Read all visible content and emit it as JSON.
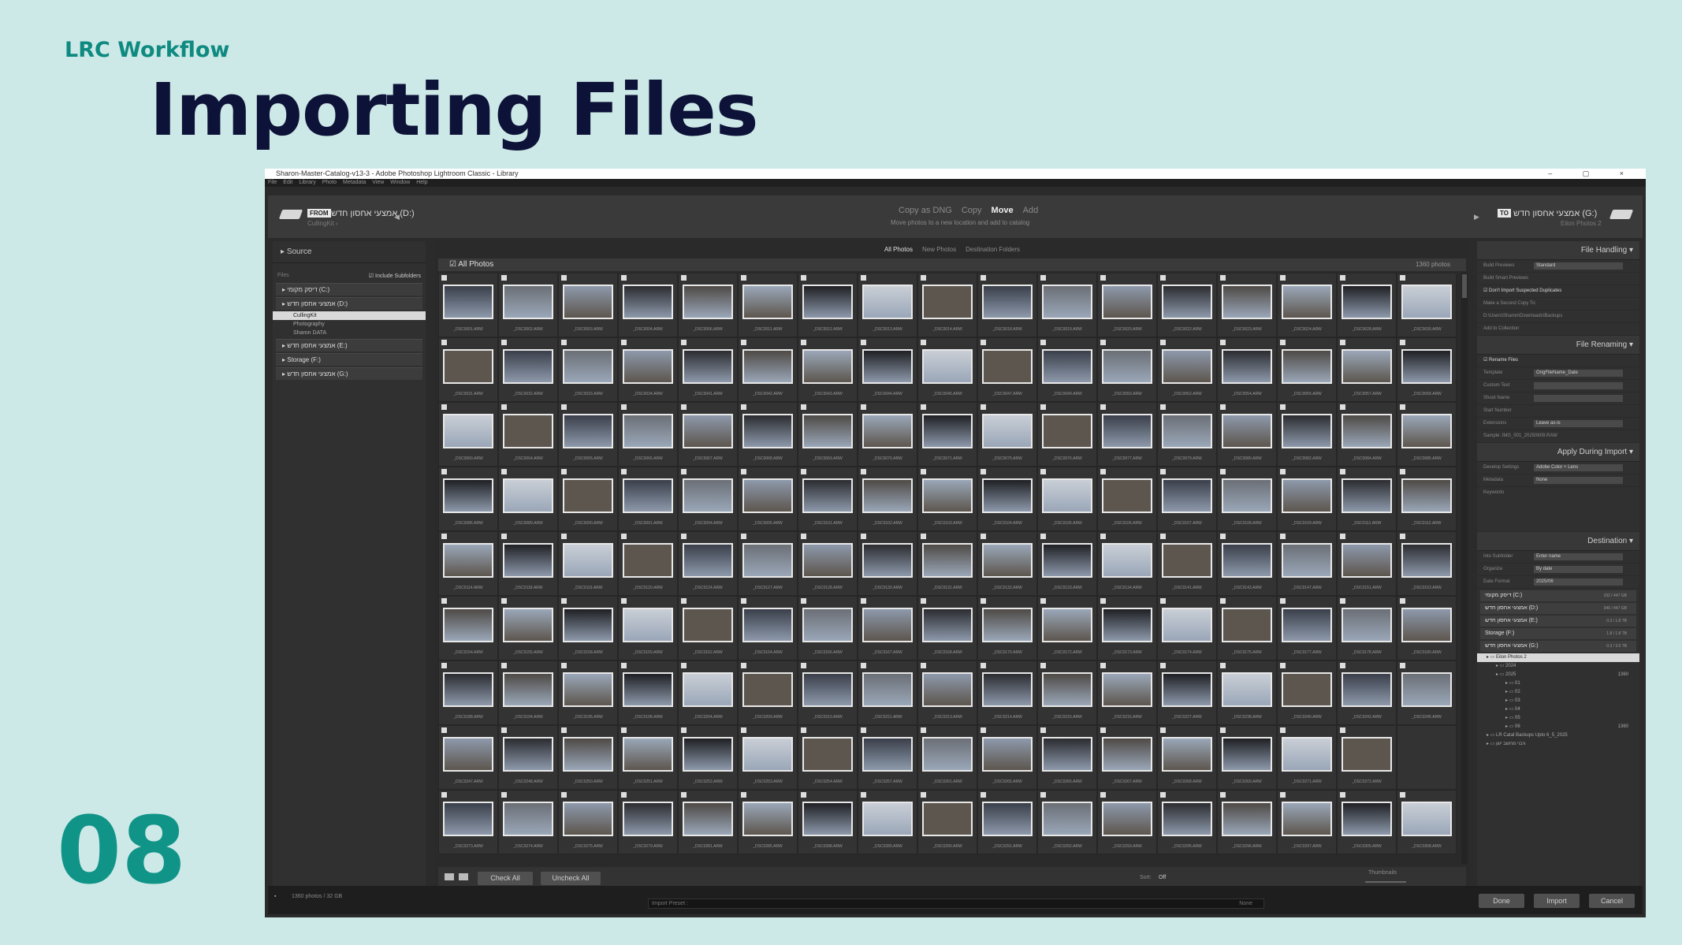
{
  "slide": {
    "kicker": "LRC Workflow",
    "title": "Importing Files",
    "number": "08"
  },
  "window": {
    "title": "Sharon-Master-Catalog-v13-3 - Adobe Photoshop Lightroom Classic - Library",
    "controls": "– ▢ ×",
    "menu": [
      "File",
      "Edit",
      "Library",
      "Photo",
      "Metadata",
      "View",
      "Window",
      "Help"
    ]
  },
  "topbar": {
    "from_tag": "FROM",
    "from_volume": "אמצעי אחסון חדש (D:)",
    "from_path": "CullingKit ›",
    "modes": [
      "Copy as DNG",
      "Copy",
      "Move",
      "Add"
    ],
    "active_mode": "Move",
    "mode_description": "Move photos to a new location and add to catalog",
    "to_tag": "TO",
    "to_volume": "אמצעי אחסון חדש (G:)",
    "to_path": "Eilon Photos 2"
  },
  "source": {
    "header": "Source",
    "files_label": "Files",
    "include_subfolders": "Include Subfolders",
    "volumes": [
      {
        "label": "דיסק מקומי (C:)"
      },
      {
        "label": "אמצעי אחסון חדש (D:)"
      }
    ],
    "subfolders": [
      "CullingKit",
      "Photography",
      "Sharon DATA"
    ],
    "selected_subfolder": "CullingKit",
    "volumes_after": [
      {
        "label": "אמצעי אחסון חדש (E:)"
      },
      {
        "label": "Storage (F:)"
      },
      {
        "label": "אמצעי אחסון חדש (G:)"
      }
    ]
  },
  "center": {
    "filters": [
      "All Photos",
      "New Photos",
      "Destination Folders"
    ],
    "active_filter": "All Photos",
    "grid_title": "All Photos",
    "photo_count": "1360 photos",
    "check_all": "Check All",
    "uncheck_all": "Uncheck All",
    "sort_label": "Sort:",
    "sort_value": "Off",
    "thumbnails_label": "Thumbnails",
    "rows": [
      [
        "_DSC0001.ARW",
        "_DSC0002.ARW",
        "_DSC0003.ARW",
        "_DSC0004.ARW",
        "_DSC0006.ARW",
        "_DSC0011.ARW",
        "_DSC0012.ARW",
        "_DSC0013.ARW",
        "_DSC0014.ARW",
        "_DSC0018.ARW",
        "_DSC0019.ARW",
        "_DSC0020.ARW",
        "_DSC0022.ARW",
        "_DSC0023.ARW",
        "_DSC0024.ARW",
        "_DSC0028.ARW",
        "_DSC0030.ARW"
      ],
      [
        "_DSC0031.ARW",
        "_DSC0032.ARW",
        "_DSC0033.ARW",
        "_DSC0034.ARW",
        "_DSC0041.ARW",
        "_DSC0042.ARW",
        "_DSC0043.ARW",
        "_DSC0044.ARW",
        "_DSC0045.ARW",
        "_DSC0047.ARW",
        "_DSC0049.ARW",
        "_DSC0050.ARW",
        "_DSC0052.ARW",
        "_DSC0054.ARW",
        "_DSC0055.ARW",
        "_DSC0057.ARW",
        "_DSC0058.ARW"
      ],
      [
        "_DSC0060.ARW",
        "_DSC0064.ARW",
        "_DSC0065.ARW",
        "_DSC0066.ARW",
        "_DSC0067.ARW",
        "_DSC0068.ARW",
        "_DSC0069.ARW",
        "_DSC0070.ARW",
        "_DSC0071.ARW",
        "_DSC0075.ARW",
        "_DSC0076.ARW",
        "_DSC0077.ARW",
        "_DSC0079.ARW",
        "_DSC0080.ARW",
        "_DSC0082.ARW",
        "_DSC0084.ARW",
        "_DSC0085.ARW"
      ],
      [
        "_DSC0086.ARW",
        "_DSC0089.ARW",
        "_DSC0090.ARW",
        "_DSC0091.ARW",
        "_DSC0094.ARW",
        "_DSC0095.ARW",
        "_DSC0101.ARW",
        "_DSC0102.ARW",
        "_DSC0103.ARW",
        "_DSC0104.ARW",
        "_DSC0105.ARW",
        "_DSC0106.ARW",
        "_DSC0107.ARW",
        "_DSC0108.ARW",
        "_DSC0109.ARW",
        "_DSC0111.ARW",
        "_DSC0112.ARW"
      ],
      [
        "_DSC0114.ARW",
        "_DSC0118.ARW",
        "_DSC0119.ARW",
        "_DSC0120.ARW",
        "_DSC0124.ARW",
        "_DSC0127.ARW",
        "_DSC0128.ARW",
        "_DSC0130.ARW",
        "_DSC0131.ARW",
        "_DSC0132.ARW",
        "_DSC0133.ARW",
        "_DSC0134.ARW",
        "_DSC0141.ARW",
        "_DSC0143.ARW",
        "_DSC0147.ARW",
        "_DSC0151.ARW",
        "_DSC0153.ARW"
      ],
      [
        "_DSC0154.ARW",
        "_DSC0155.ARW",
        "_DSC0158.ARW",
        "_DSC0159.ARW",
        "_DSC0162.ARW",
        "_DSC0164.ARW",
        "_DSC0166.ARW",
        "_DSC0167.ARW",
        "_DSC0168.ARW",
        "_DSC0170.ARW",
        "_DSC0172.ARW",
        "_DSC0173.ARW",
        "_DSC0174.ARW",
        "_DSC0175.ARW",
        "_DSC0177.ARW",
        "_DSC0178.ARW",
        "_DSC0180.ARW"
      ],
      [
        "_DSC0188.ARW",
        "_DSC0194.ARW",
        "_DSC0195.ARW",
        "_DSC0198.ARW",
        "_DSC0204.ARW",
        "_DSC0209.ARW",
        "_DSC0210.ARW",
        "_DSC0211.ARW",
        "_DSC0213.ARW",
        "_DSC0214.ARW",
        "_DSC0215.ARW",
        "_DSC0216.ARW",
        "_DSC0227.ARW",
        "_DSC0238.ARW",
        "_DSC0240.ARW",
        "_DSC0242.ARW",
        "_DSC0245.ARW"
      ],
      [
        "_DSC0247.ARW",
        "_DSC0248.ARW",
        "_DSC0250.ARW",
        "_DSC0251.ARW",
        "_DSC0252.ARW",
        "_DSC0253.ARW",
        "_DSC0254.ARW",
        "_DSC0257.ARW",
        "_DSC0261.ARW",
        "_DSC0265.ARW",
        "_DSC0266.ARW",
        "_DSC0267.ARW",
        "_DSC0268.ARW",
        "_DSC0269.ARW",
        "_DSC0271.ARW",
        "_DSC0272.ARW"
      ],
      [
        "_DSC0273.ARW",
        "_DSC0274.ARW",
        "_DSC0275.ARW",
        "_DSC0279.ARW",
        "_DSC0281.ARW",
        "_DSC0285.ARW",
        "_DSC0288.ARW",
        "_DSC0289.ARW",
        "_DSC0290.ARW",
        "_DSC0291.ARW",
        "_DSC0292.ARW",
        "_DSC0293.ARW",
        "_DSC0295.ARW",
        "_DSC0296.ARW",
        "_DSC0297.ARW",
        "_DSC0305.ARW",
        "_DSC0308.ARW"
      ]
    ],
    "thumb_colors": [
      "#3a3f4a",
      "#6b6f76",
      "#8d99ab",
      "#2b2c30",
      "#4e4a46",
      "#9aa7b8",
      "#1f2024",
      "#c9ced6",
      "#5d564e"
    ]
  },
  "right": {
    "file_handling": {
      "header": "File Handling",
      "build_previews_label": "Build Previews",
      "build_previews_value": "Standard",
      "smart_previews": "Build Smart Previews",
      "dont_import_dupes": "Don't Import Suspected Duplicates",
      "second_copy": "Make a Second Copy To:",
      "second_copy_path": "D:\\Users\\Sharon\\Downloads\\Backups",
      "add_to_collection": "Add to Collection"
    },
    "file_renaming": {
      "header": "File Renaming",
      "rename_files": "Rename Files",
      "template_label": "Template",
      "template_value": "OrigFileName_Date",
      "custom_text": "Custom Text",
      "shoot_name": "Shoot Name",
      "start_number": "Start Number",
      "extensions_label": "Extensions",
      "extensions_value": "Leave as-is",
      "sample_label": "Sample:",
      "sample_value": "IMG_001_20250609.RAW"
    },
    "apply_during_import": {
      "header": "Apply During Import",
      "develop_label": "Develop Settings",
      "develop_value": "Adobe Color + Lens",
      "metadata_label": "Metadata",
      "metadata_value": "None",
      "keywords_label": "Keywords"
    },
    "destination": {
      "header": "Destination",
      "into_subfolder": "Into Subfolder",
      "into_subfolder_value": "Enter name",
      "organize_label": "Organize",
      "organize_value": "By date",
      "date_format_label": "Date Format",
      "date_format_value": "2025/06",
      "volumes": [
        {
          "label": "דיסק מקומי (C:)",
          "size": "192 / 447 GB"
        },
        {
          "label": "אמצעי אחסון חדש (D:)",
          "size": "346 / 447 GB"
        },
        {
          "label": "אמצעי אחסון חדש (E:)",
          "size": "0.3 / 1.8 TB"
        },
        {
          "label": "Storage (F:)",
          "size": "1.8 / 1.8 TB"
        },
        {
          "label": "אמצעי אחסון חדש (G:)",
          "size": "0.3 / 3.6 TB"
        }
      ],
      "tree": [
        {
          "label": "Eilon Photos 2",
          "count": "",
          "indent": 1,
          "selected": true
        },
        {
          "label": "2024",
          "count": "",
          "indent": 2,
          "selected": false
        },
        {
          "label": "2025",
          "count": "1360",
          "indent": 2,
          "selected": false
        },
        {
          "label": "01",
          "count": "",
          "indent": 3,
          "selected": false
        },
        {
          "label": "02",
          "count": "",
          "indent": 3,
          "selected": false
        },
        {
          "label": "03",
          "count": "",
          "indent": 3,
          "selected": false
        },
        {
          "label": "04",
          "count": "",
          "indent": 3,
          "selected": false
        },
        {
          "label": "05",
          "count": "",
          "indent": 3,
          "selected": false
        },
        {
          "label": "06",
          "count": "1360",
          "indent": 3,
          "selected": false
        },
        {
          "label": "LR Catal Backups Upto 6_5_2025",
          "count": "",
          "indent": 1,
          "selected": false
        },
        {
          "label": "גיבוי מחשב ישן",
          "count": "",
          "indent": 1,
          "selected": false
        }
      ]
    }
  },
  "bottom": {
    "status": "1360 photos / 32 GB",
    "import_preset_label": "Import Preset :",
    "import_preset_value": "None",
    "done": "Done",
    "import": "Import",
    "cancel": "Cancel"
  }
}
